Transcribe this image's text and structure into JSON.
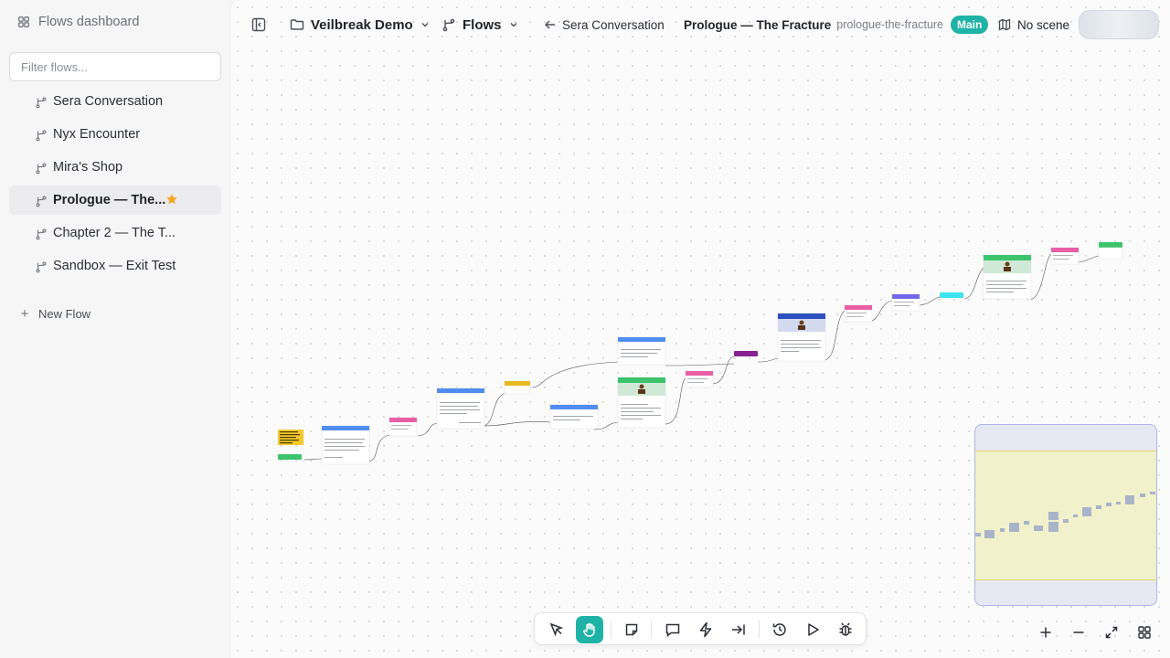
{
  "sidebar": {
    "header_label": "Flows dashboard",
    "filter_placeholder": "Filter flows...",
    "items": [
      {
        "label": "Sera Conversation"
      },
      {
        "label": "Nyx Encounter"
      },
      {
        "label": "Mira's Shop"
      },
      {
        "label": "Prologue — The...",
        "active": true,
        "starred": true
      },
      {
        "label": "Chapter 2 — The T..."
      },
      {
        "label": "Sandbox — Exit Test"
      }
    ],
    "new_flow_label": "New Flow"
  },
  "topbar": {
    "project_name": "Veilbreak Demo",
    "flows_menu_label": "Flows",
    "back_label": "Sera Conversation",
    "flow_title": "Prologue — The Fracture",
    "flow_slug": "prologue-the-fracture",
    "flow_badge": "Main",
    "scene_label": "No scene"
  },
  "toolbar": {
    "tools": [
      "select-icon",
      "hand-icon",
      "note-icon",
      "comment-icon",
      "lightning-icon",
      "jump-icon",
      "history-icon",
      "play-icon",
      "debug-icon"
    ],
    "active_tool": "hand-icon",
    "accent": "#1fb3a7"
  },
  "zoom_controls": [
    "zoom-in-icon",
    "zoom-out-icon",
    "fit-view-icon",
    "grid-icon"
  ],
  "colors": {
    "accent_teal": "#1fb3a7",
    "star": "#f5a524",
    "node_blue": "#4f8ef0",
    "node_pink": "#e95fa6",
    "node_green": "#3cc46c",
    "node_yellow": "#e8b81f",
    "node_purple": "#8a1f8f",
    "node_indigo": "#7166e8",
    "node_cyan": "#3ce3f0",
    "node_darkblue": "#2d4fbf"
  },
  "graph_nodes": [
    {
      "kind": "sticky-note",
      "color": "#f5c82e"
    },
    {
      "kind": "entry",
      "color": "#3cc46c"
    },
    {
      "kind": "dialogue",
      "color": "#4f8ef0"
    },
    {
      "kind": "condition",
      "color": "#e95fa6"
    },
    {
      "kind": "dialogue",
      "color": "#4f8ef0"
    },
    {
      "kind": "hub",
      "color": "#e8b81f"
    },
    {
      "kind": "dialogue",
      "color": "#4f8ef0"
    },
    {
      "kind": "dialogue",
      "color": "#4f8ef0"
    },
    {
      "kind": "character",
      "color": "#3cc46c"
    },
    {
      "kind": "condition",
      "color": "#e95fa6"
    },
    {
      "kind": "jump",
      "color": "#8a1f8f"
    },
    {
      "kind": "character",
      "color": "#2d4fbf"
    },
    {
      "kind": "condition",
      "color": "#e95fa6"
    },
    {
      "kind": "instruction",
      "color": "#7166e8"
    },
    {
      "kind": "event",
      "color": "#3ce3f0"
    },
    {
      "kind": "character",
      "color": "#3cc46c"
    },
    {
      "kind": "condition",
      "color": "#e95fa6"
    },
    {
      "kind": "exit",
      "color": "#3cc46c"
    }
  ]
}
